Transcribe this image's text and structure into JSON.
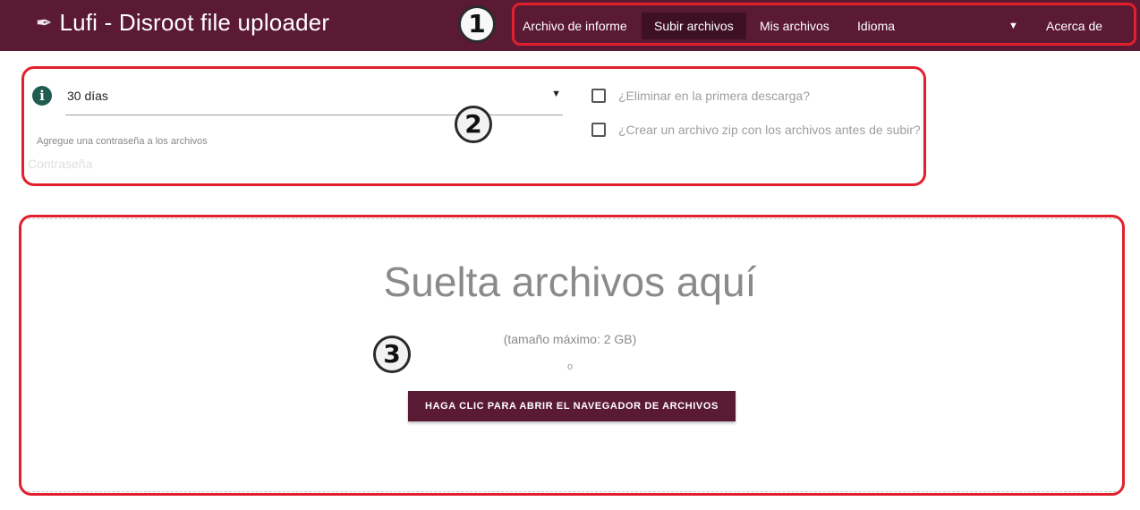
{
  "header": {
    "title": "Lufi - Disroot file uploader",
    "logo_icon": "feather-icon",
    "bg_color": "#5b1a33"
  },
  "nav": {
    "items": [
      {
        "label": "Archivo de informe",
        "active": false
      },
      {
        "label": "Subir archivos",
        "active": true
      },
      {
        "label": "Mis archivos",
        "active": false
      },
      {
        "label": "Idioma",
        "active": false
      },
      {
        "label": "Acerca de",
        "active": false
      }
    ],
    "language_caret": "▼"
  },
  "markers": [
    "1",
    "2",
    "3"
  ],
  "options": {
    "delay_value": "30 días",
    "delay_caret": "▼",
    "info_icon": "i",
    "password_label": "Agregue una contraseña a los archivos",
    "password_placeholder": "Contraseña",
    "delete_first_download": "¿Eliminar en la primera descarga?",
    "zip_files": "¿Crear un archivo zip con los archivos antes de subir?"
  },
  "dropzone": {
    "title": "Suelta archivos aquí",
    "max_size": "(tamaño máximo: 2 GB)",
    "or": "o",
    "button_label": "HAGA CLIC PARA ABRIR EL NAVEGADOR DE ARCHIVOS"
  },
  "colors": {
    "accent": "#5b1a33",
    "highlight": "#e21f2d"
  }
}
